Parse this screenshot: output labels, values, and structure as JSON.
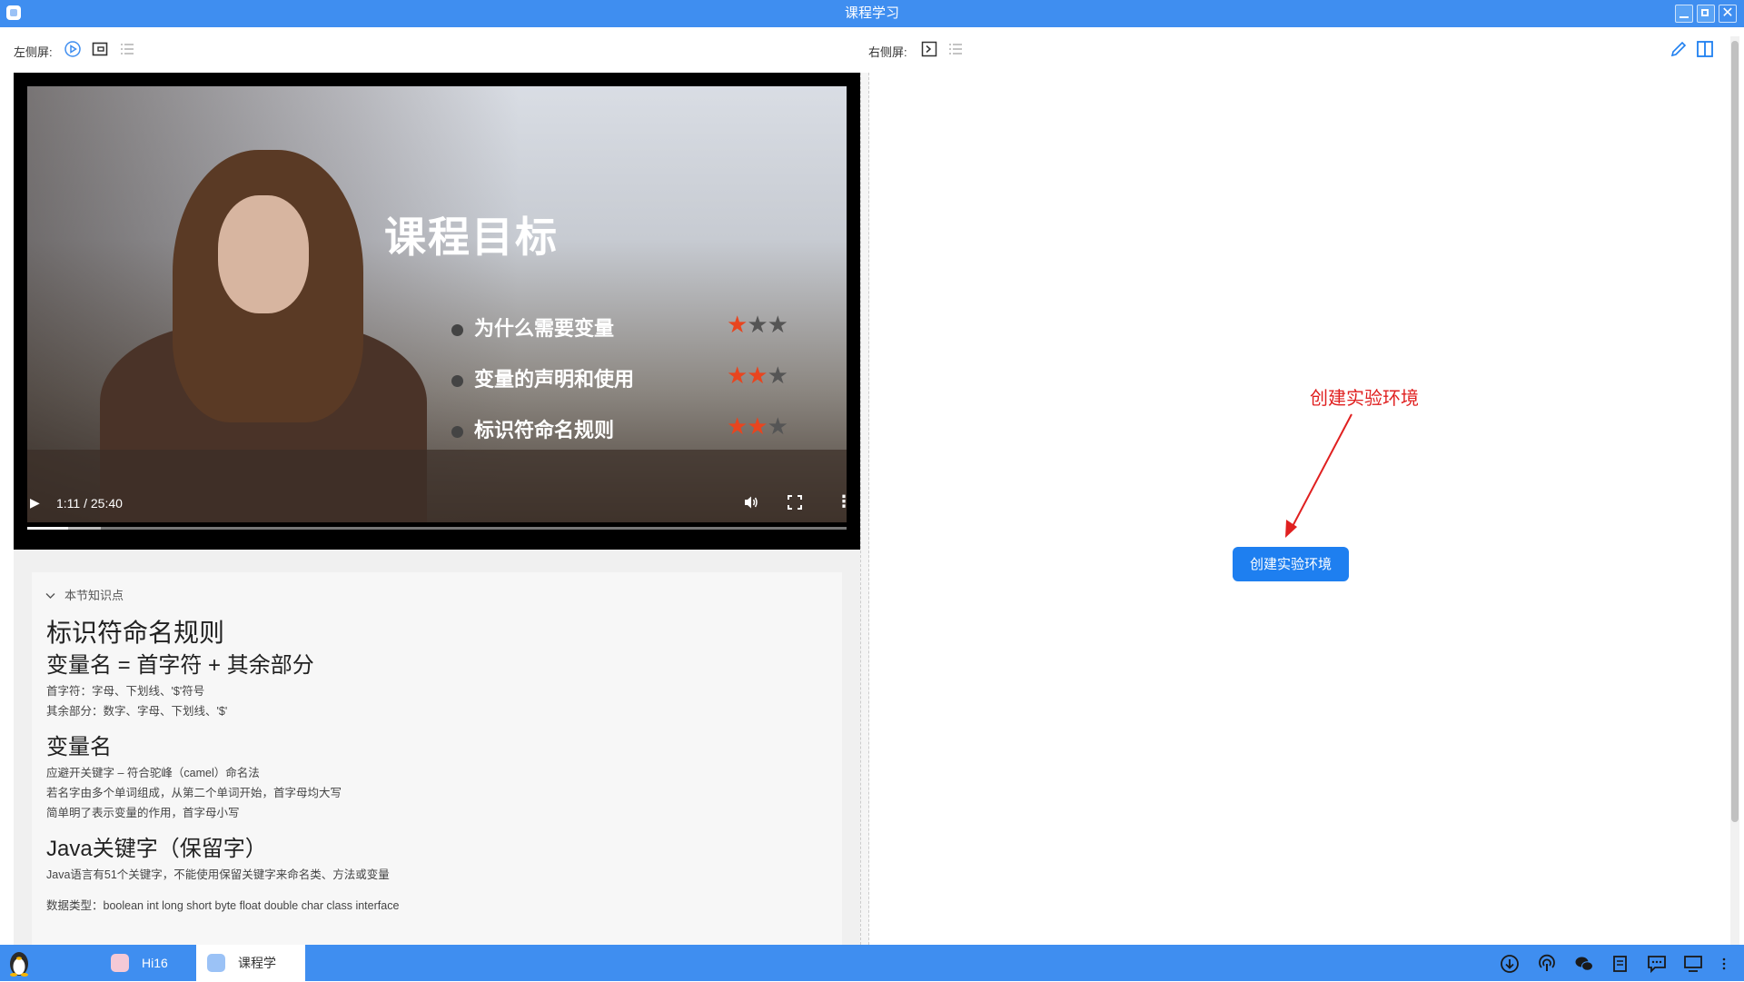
{
  "window": {
    "title": "课程学习",
    "close_glyph": "✕"
  },
  "toolbar": {
    "left_label": "左侧屏:",
    "right_label": "右侧屏:"
  },
  "video": {
    "slide_title": "课程目标",
    "goals": [
      {
        "text": "为什么需要变量",
        "rating": 1,
        "max": 3
      },
      {
        "text": "变量的声明和使用",
        "rating": 2,
        "max": 3
      },
      {
        "text": "标识符命名规则",
        "rating": 2,
        "max": 3
      }
    ],
    "time": "1:11 / 25:40",
    "progress": 0.05,
    "buffered": 0.09
  },
  "knowledge": {
    "header": "本节知识点",
    "h1": "标识符命名规则",
    "h2a": "变量名 = 首字符 + 其余部分",
    "p1": "首字符：字母、下划线、'$'符号",
    "p2": "其余部分：数字、字母、下划线、'$'",
    "h2b": "变量名",
    "p3": "应避开关键字 – 符合驼峰（camel）命名法",
    "p4": "若名字由多个单词组成，从第二个单词开始，首字母均大写",
    "p5": "简单明了表示变量的作用，首字母小写",
    "h2c": "Java关键字（保留字）",
    "p6": "Java语言有51个关键字，不能使用保留关键字来命名类、方法或变量",
    "p7": "数据类型：boolean int long short byte float double char class interface"
  },
  "right": {
    "annotation": "创建实验环境",
    "button": "创建实验环境"
  },
  "taskbar": {
    "tasks": [
      {
        "label": "Hi16"
      },
      {
        "label": "课程学"
      }
    ]
  },
  "colors": {
    "accent": "#3f8ef0",
    "button": "#1e7ff0",
    "annotation": "#e02020",
    "star": "#e8451f"
  }
}
